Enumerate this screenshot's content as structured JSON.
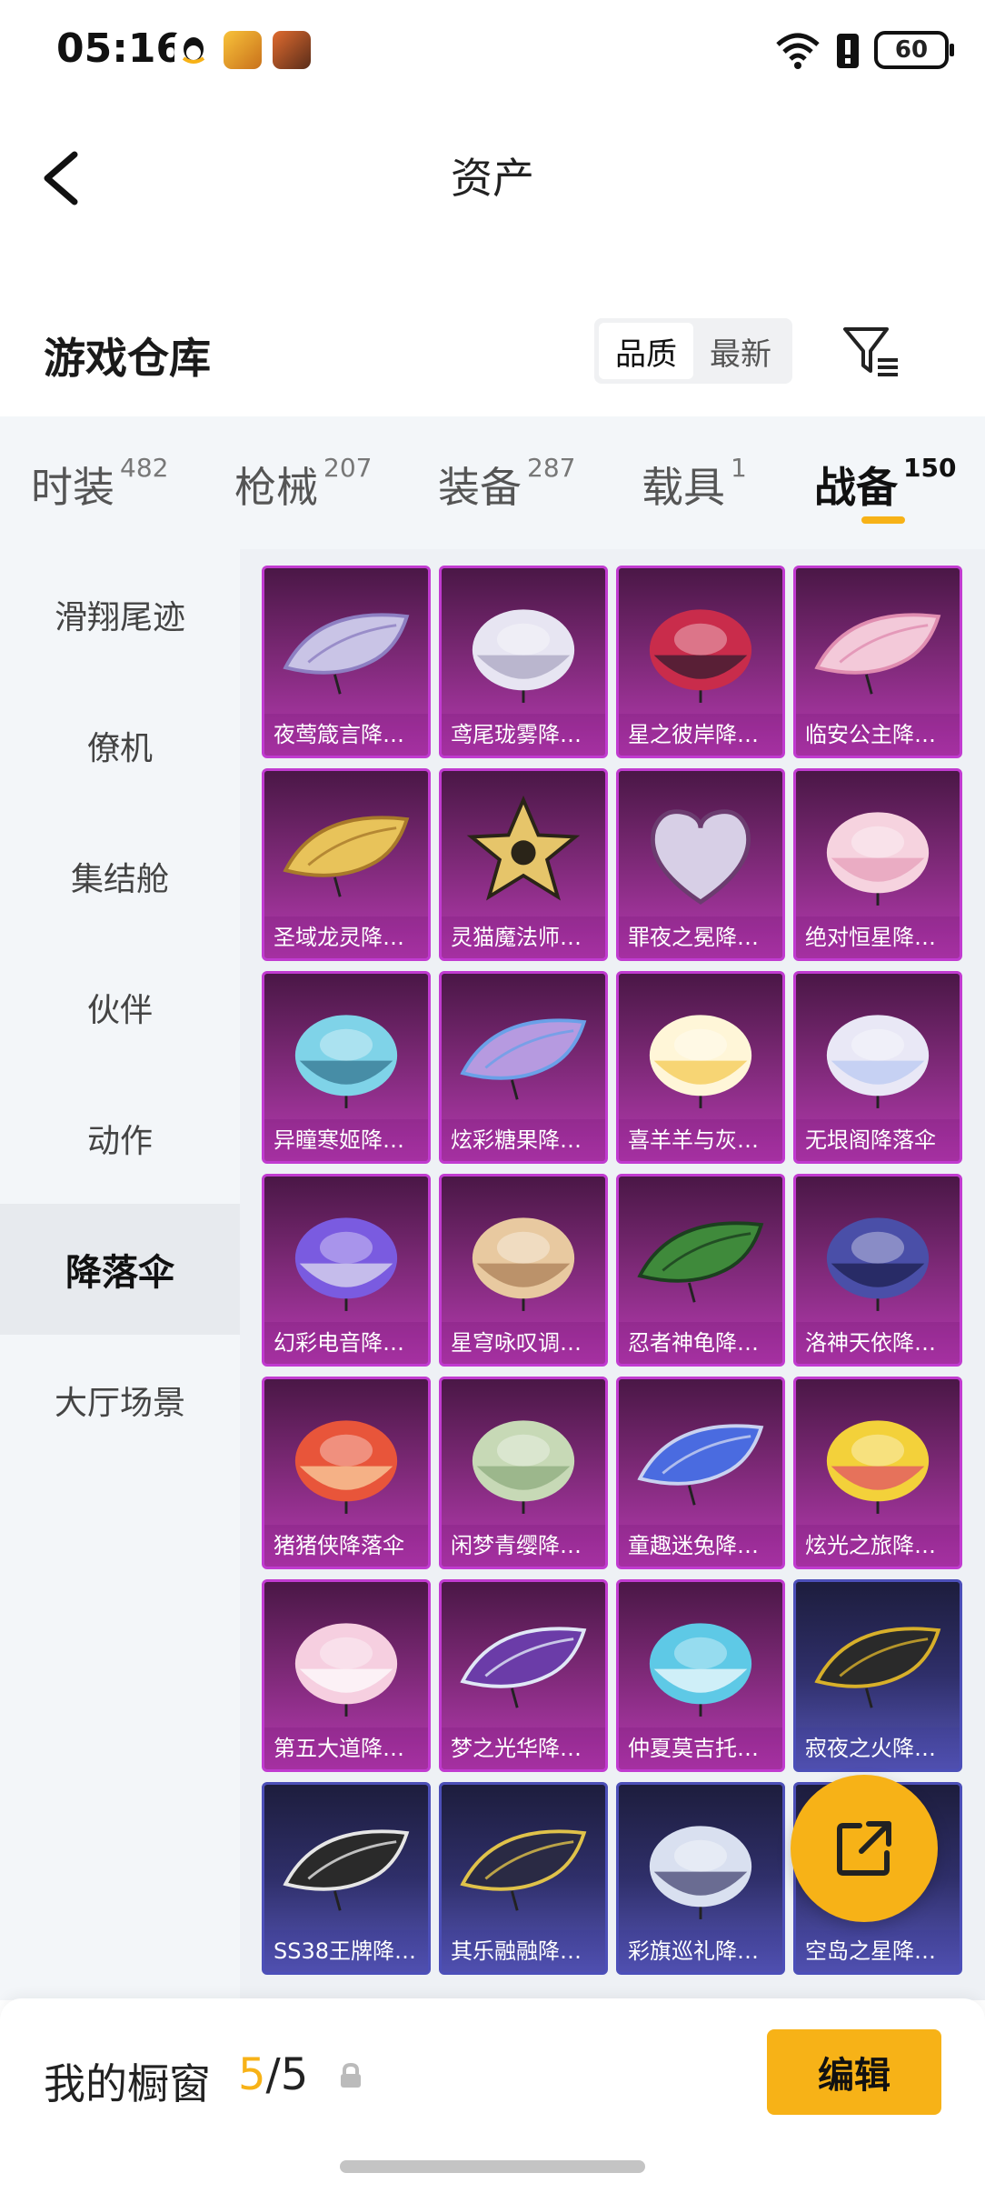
{
  "status_bar": {
    "time": "05:16",
    "battery": "60",
    "icons": [
      "qq-icon",
      "game-app-icon",
      "hero-app-icon",
      "wifi-icon",
      "battery-alert-icon"
    ]
  },
  "header": {
    "title": "资产"
  },
  "warehouse": {
    "title": "游戏仓库",
    "sort_options": [
      "品质",
      "最新"
    ]
  },
  "tabs": [
    {
      "label": "时装",
      "count": "482"
    },
    {
      "label": "枪械",
      "count": "207"
    },
    {
      "label": "装备",
      "count": "287"
    },
    {
      "label": "载具",
      "count": "1"
    },
    {
      "label": "战备",
      "count": "150"
    }
  ],
  "sidebar": {
    "items": [
      "滑翔尾迹",
      "僚机",
      "集结舱",
      "伙伴",
      "动作",
      "降落伞",
      "大厅场景"
    ]
  },
  "items": [
    {
      "name": "夜莺箴言降…"
    },
    {
      "name": "鸢尾珑雾降…"
    },
    {
      "name": "星之彼岸降…"
    },
    {
      "name": "临安公主降…"
    },
    {
      "name": "圣域龙灵降…"
    },
    {
      "name": "灵猫魔法师…"
    },
    {
      "name": "罪夜之冕降…"
    },
    {
      "name": "绝对恒星降…"
    },
    {
      "name": "异瞳寒姬降…"
    },
    {
      "name": "炫彩糖果降…"
    },
    {
      "name": "喜羊羊与灰…"
    },
    {
      "name": "无垠阁降落伞"
    },
    {
      "name": "幻彩电音降…"
    },
    {
      "name": "星穹咏叹调…"
    },
    {
      "name": "忍者神龟降…"
    },
    {
      "name": "洛神天依降…"
    },
    {
      "name": "猪猪侠降落伞"
    },
    {
      "name": "闲梦青缨降…"
    },
    {
      "name": "童趣迷兔降…"
    },
    {
      "name": "炫光之旅降…"
    },
    {
      "name": "第五大道降…"
    },
    {
      "name": "梦之光华降…"
    },
    {
      "name": "仲夏莫吉托…"
    },
    {
      "name": "寂夜之火降…"
    },
    {
      "name": "SS38王牌降…"
    },
    {
      "name": "其乐融融降…"
    },
    {
      "name": "彩旗巡礼降…"
    },
    {
      "name": "空岛之星降…"
    }
  ],
  "bottom": {
    "showcase_label": "我的橱窗",
    "showcase_current": "5",
    "showcase_sep": "/",
    "showcase_total": "5",
    "edit_label": "编辑"
  },
  "colors": {
    "accent": "#f7b217",
    "card_purple": "#b53ab0",
    "card_blue": "#5656b8"
  }
}
